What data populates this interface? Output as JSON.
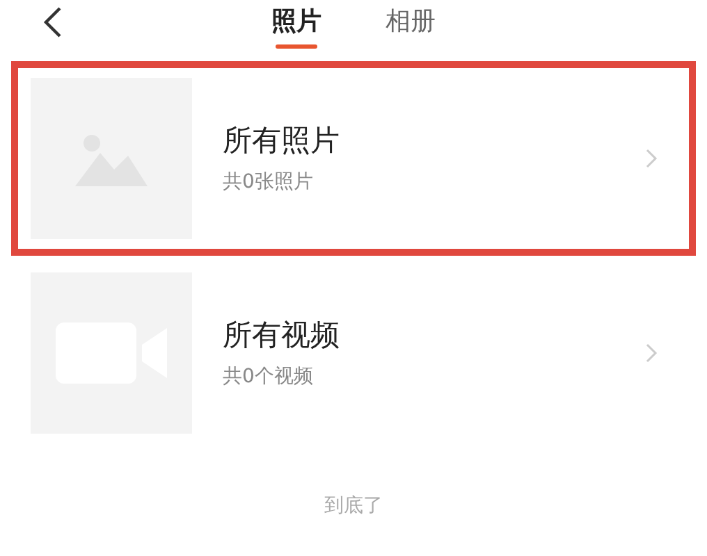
{
  "tabs": [
    {
      "label": "照片",
      "selected": true
    },
    {
      "label": "相册",
      "selected": false
    }
  ],
  "albums": [
    {
      "kind": "photo",
      "title": "所有照片",
      "subtitle": "共0张照片",
      "highlighted": true
    },
    {
      "kind": "video",
      "title": "所有视频",
      "subtitle": "共0个视频",
      "highlighted": false
    }
  ],
  "footer": "到底了"
}
